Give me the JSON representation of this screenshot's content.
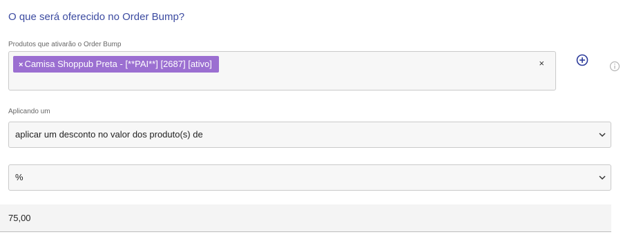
{
  "title": "O que será oferecido no Order Bump?",
  "products": {
    "label": "Produtos que ativarão o Order Bump",
    "tags": [
      {
        "remove_symbol": "×",
        "label": "Camisa Shoppub Preta - [**PAI**] [2687] [ativo]"
      }
    ],
    "clear_symbol": "×"
  },
  "applying": {
    "label": "Aplicando um",
    "selected": "aplicar um desconto no valor dos produto(s) de"
  },
  "unit_select": {
    "selected": "%"
  },
  "value_input": {
    "value": "75,00"
  },
  "icons": {
    "add": "plus-circle-icon",
    "info": "info-icon",
    "dropdown": "chevron-down-icon"
  },
  "colors": {
    "title": "#3b4aa0",
    "tag_background": "#9b6fd1",
    "add_icon": "#2b3a9a"
  }
}
